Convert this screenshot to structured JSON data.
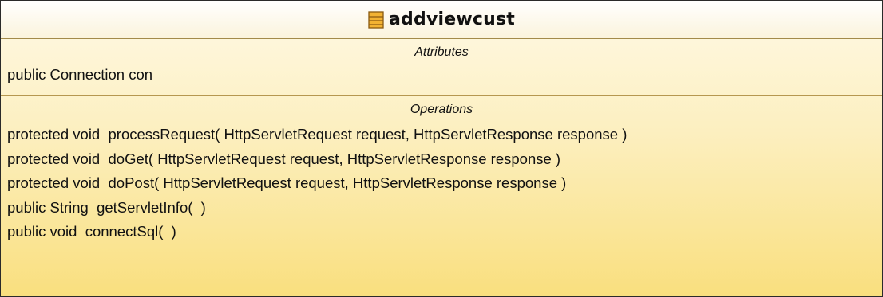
{
  "class": {
    "name": "addviewcust",
    "icon": "class-icon"
  },
  "attributes": {
    "title": "Attributes",
    "items": [
      "public Connection con"
    ]
  },
  "operations": {
    "title": "Operations",
    "items": [
      "protected void  processRequest( HttpServletRequest request, HttpServletResponse response )",
      "protected void  doGet( HttpServletRequest request, HttpServletResponse response )",
      "protected void  doPost( HttpServletRequest request, HttpServletResponse response )",
      "public String  getServletInfo(  )",
      "public void  connectSql(  )"
    ]
  },
  "colors": {
    "border": "#2a2a2a",
    "fill_top": "#fff9e6",
    "fill_bottom": "#f9df7e",
    "icon_fill": "#f2b233",
    "icon_border": "#8a5a10"
  }
}
